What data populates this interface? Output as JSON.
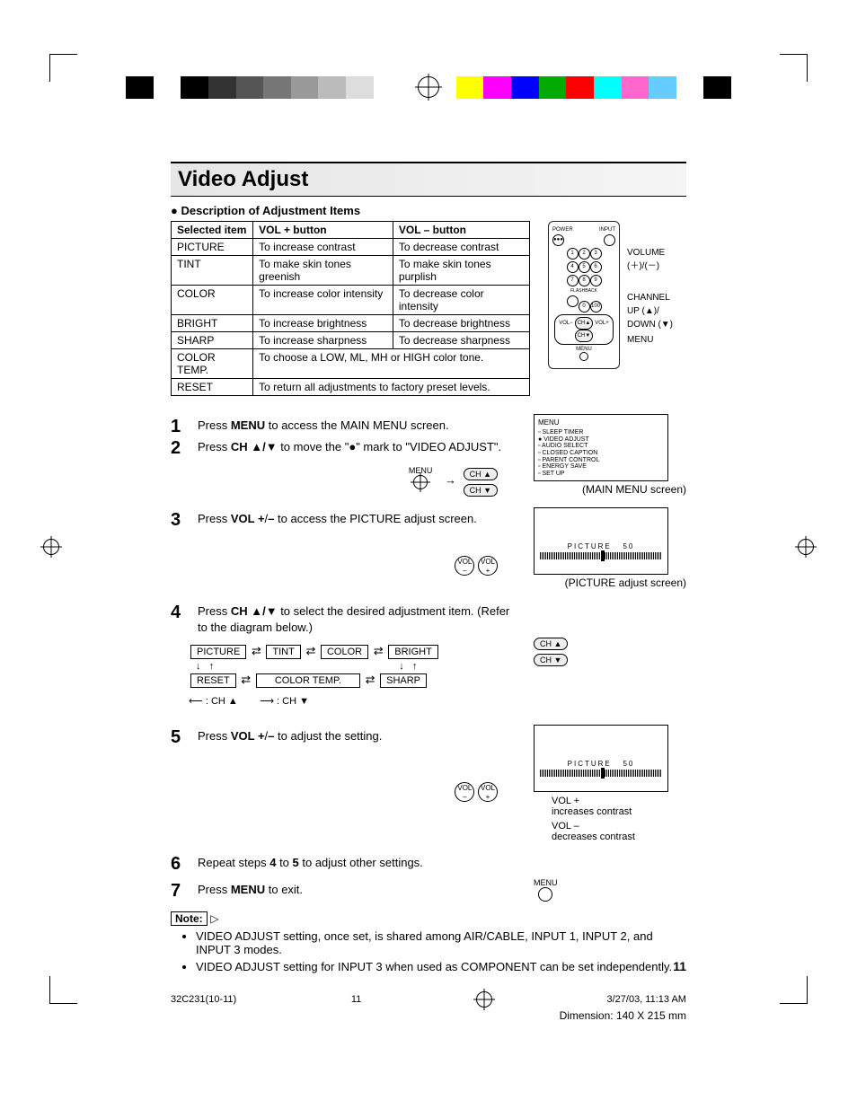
{
  "title": "Video Adjust",
  "subhead": "Description of Adjustment Items",
  "table": {
    "headers": [
      "Selected item",
      "VOL + button",
      "VOL – button"
    ],
    "rows": [
      [
        "PICTURE",
        "To increase contrast",
        "To decrease contrast"
      ],
      [
        "TINT",
        "To make skin tones greenish",
        "To make skin tones purplish"
      ],
      [
        "COLOR",
        "To increase color intensity",
        "To decrease color intensity"
      ],
      [
        "BRIGHT",
        "To increase brightness",
        "To decrease brightness"
      ],
      [
        "SHARP",
        "To increase sharpness",
        "To decrease sharpness"
      ]
    ],
    "colortemp_label": "COLOR TEMP.",
    "colortemp_text": "To choose a LOW, ML, MH or HIGH color tone.",
    "reset_label": "RESET",
    "reset_text": "To return all adjustments to factory preset levels."
  },
  "remote_labels": {
    "volume": "VOLUME\n(＋)/(－)",
    "channel": "CHANNEL\nUP (▲)/\nDOWN (▼)",
    "menu": "MENU",
    "power": "POWER",
    "input": "INPUT",
    "flashback": "FLASHBACK"
  },
  "steps": {
    "s1_pre": "Press ",
    "s1_bold": "MENU",
    "s1_post": " to access the MAIN MENU screen.",
    "s2_pre": "Press ",
    "s2_bold": "CH ▲/▼",
    "s2_post": " to move the \"●\" mark to \"VIDEO ADJUST\".",
    "s3_pre": "Press ",
    "s3_bold": "VOL +",
    "s3_mid": "/",
    "s3_bold2": "–",
    "s3_post": " to access the PICTURE adjust screen.",
    "s4_pre": "Press ",
    "s4_bold": "CH ▲/▼",
    "s4_post": " to select the desired adjustment item. (Refer to the diagram below.)",
    "s5_pre": "Press ",
    "s5_bold": "VOL +",
    "s5_mid": "/",
    "s5_bold2": "–",
    "s5_post": " to adjust the setting.",
    "s6_pre": "Repeat steps ",
    "s6_b1": "4",
    "s6_mid": " to ",
    "s6_b2": "5",
    "s6_post": " to adjust other settings.",
    "s7_pre": "Press ",
    "s7_bold": "MENU",
    "s7_post": " to exit."
  },
  "menu_screen": {
    "title": "MENU",
    "items": [
      "SLEEP TIMER",
      "VIDEO ADJUST",
      "AUDIO SELECT",
      "CLOSED CAPTION",
      "PARENT CONTROL",
      "ENERGY SAVE",
      "SET UP"
    ],
    "caption": "(MAIN MENU screen)"
  },
  "picture_screen": {
    "label": "PICTURE",
    "value": "50",
    "caption": "(PICTURE adjust screen)"
  },
  "diagram": {
    "picture": "PICTURE",
    "tint": "TINT",
    "color": "COLOR",
    "bright": "BRIGHT",
    "reset": "RESET",
    "colortemp": "COLOR TEMP.",
    "sharp": "SHARP",
    "legend_up": "⟵ : CH ▲",
    "legend_down": "⟶ : CH ▼"
  },
  "adjust_screen": {
    "label": "PICTURE",
    "value": "50",
    "inc": "VOL +\nincreases contrast",
    "dec": "VOL –\ndecreases contrast"
  },
  "buttons": {
    "menu": "MENU",
    "chup": "CH ▲",
    "chdn": "CH ▼",
    "volm": "VOL\n–",
    "volp": "VOL\n+"
  },
  "note_label": "Note:",
  "notes": [
    "VIDEO ADJUST setting, once set, is shared among AIR/CABLE, INPUT 1, INPUT 2, and INPUT 3 modes.",
    "VIDEO ADJUST setting for INPUT 3 when used as COMPONENT can be set independently."
  ],
  "page_number": "11",
  "footer": {
    "doc": "32C231(10-11)",
    "page": "11",
    "date": "3/27/03, 11:13 AM",
    "dimension": "Dimension: 140  X 215 mm"
  }
}
